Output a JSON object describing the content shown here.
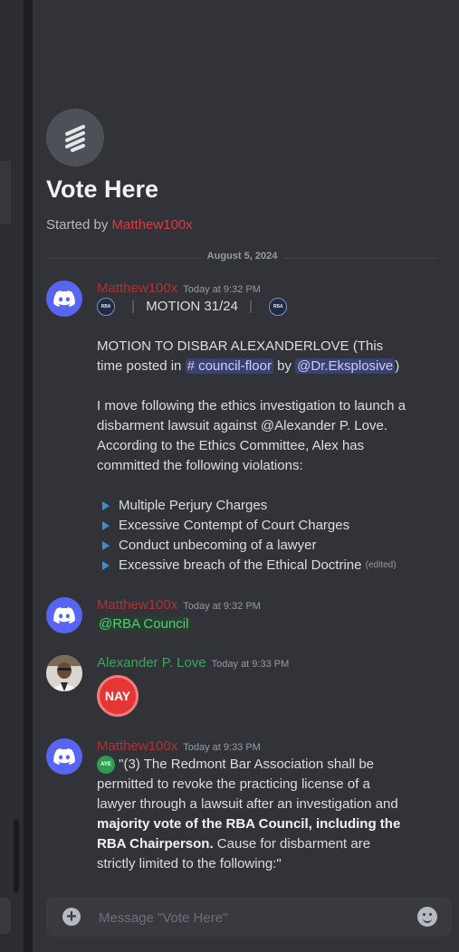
{
  "thread": {
    "title": "Vote Here",
    "started_prefix": "Started by ",
    "started_user": "Matthew100x",
    "date": "August 5, 2024"
  },
  "messages": [
    {
      "user": "Matthew100x",
      "time": "Today at 9:32 PM",
      "badge": "RBA",
      "motion_line": "MOTION 31/24",
      "line1_pre": "MOTION TO DISBAR ALEXANDERLOVE (This time posted in ",
      "channel": "# council-floor",
      "by": " by ",
      "user_mention": "@Dr.Eksplosive",
      "close": ")",
      "para2": "I move following the ethics investigation to launch a disbarment lawsuit against @Alexander P. Love. According to the Ethics Committee, Alex has committed the following violations:",
      "bullets": [
        "Multiple Perjury Charges",
        "Excessive Contempt of Court Charges",
        "Conduct unbecoming of a lawyer",
        "Excessive breach of the Ethical Doctrine"
      ],
      "edited": "(edited)"
    },
    {
      "user": "Matthew100x",
      "time": "Today at 9:32 PM",
      "role_mention": "@RBA Council"
    },
    {
      "user": "Alexander P. Love",
      "time": "Today at 9:33 PM",
      "vote": "NAY"
    },
    {
      "user": "Matthew100x",
      "time": "Today at 9:33 PM",
      "aye": "AYE",
      "quote_pre": " \"(3) The Redmont Bar Association shall be permitted to revoke the practicing license of a lawyer through a lawsuit after an investigation and ",
      "quote_bold": "majority vote of the RBA Council, including the RBA Chairperson.",
      "quote_post": " Cause for disbarment are strictly limited to the following:\""
    }
  ],
  "composer": {
    "placeholder": "Message \"Vote Here\""
  },
  "colors": {
    "accent": "#5865f2",
    "username_red": "#b82e30",
    "username_green": "#3ba55c"
  }
}
